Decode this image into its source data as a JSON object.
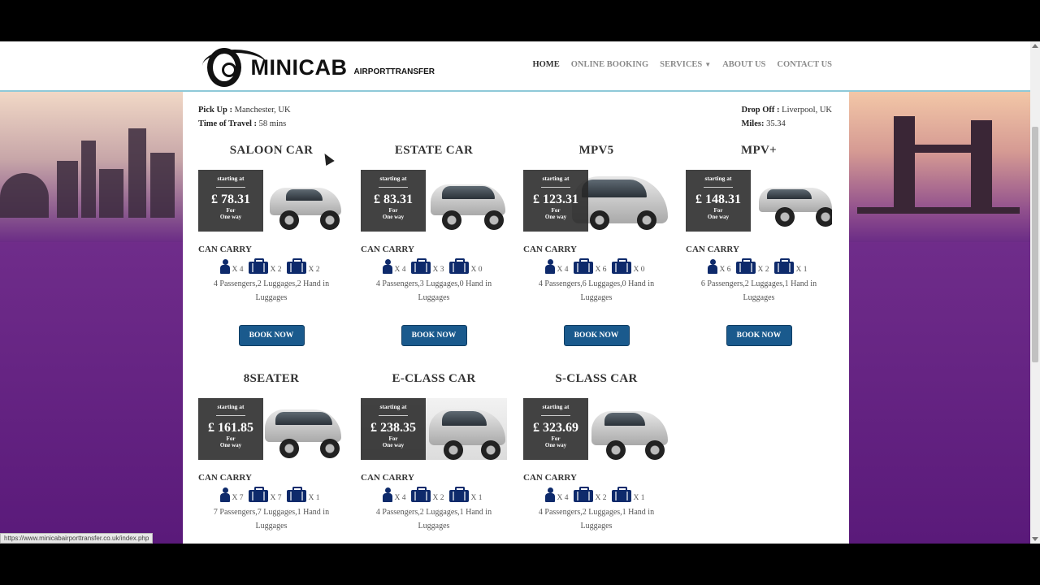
{
  "header": {
    "logo_main": "MINICAB",
    "logo_sub": "AIRPORTTRANSFER",
    "nav": [
      {
        "label": "HOME",
        "active": true
      },
      {
        "label": "ONLINE BOOKING"
      },
      {
        "label": "SERVICES"
      },
      {
        "label": "ABOUT US"
      },
      {
        "label": "CONTACT US"
      }
    ]
  },
  "trip": {
    "pickup_label": "Pick Up :",
    "pickup_value": "Manchester, UK",
    "time_label": "Time of Travel :",
    "time_value": "58 mins",
    "dropoff_label": "Drop Off :",
    "dropoff_value": "Liverpool, UK",
    "miles_label": "Miles:",
    "miles_value": "35.34"
  },
  "labels": {
    "starting_at": "starting at",
    "for": "For",
    "one_way": "One way",
    "can_carry": "CAN CARRY",
    "book_now": "BOOK NOW"
  },
  "cars": [
    {
      "name": "SALOON CAR",
      "price": "£ 78.31",
      "passengers": "X 4",
      "luggages": "X 2",
      "hand": "X 2",
      "desc": "4 Passengers,2 Luggages,2 Hand in Luggages"
    },
    {
      "name": "ESTATE CAR",
      "price": "£ 83.31",
      "passengers": "X 4",
      "luggages": "X 3",
      "hand": "X 0",
      "desc": "4 Passengers,3 Luggages,0 Hand in Luggages"
    },
    {
      "name": "MPV5",
      "price": "£ 123.31",
      "passengers": "X 4",
      "luggages": "X 6",
      "hand": "X 0",
      "desc": "4 Passengers,6 Luggages,0 Hand in Luggages"
    },
    {
      "name": "MPV+",
      "price": "£ 148.31",
      "passengers": "X 6",
      "luggages": "X 2",
      "hand": "X 1",
      "desc": "6 Passengers,2 Luggages,1 Hand in Luggages"
    },
    {
      "name": "8SEATER",
      "price": "£ 161.85",
      "passengers": "X 7",
      "luggages": "X 7",
      "hand": "X 1",
      "desc": "7 Passengers,7 Luggages,1 Hand in Luggages"
    },
    {
      "name": "E-CLASS CAR",
      "price": "£ 238.35",
      "passengers": "X 4",
      "luggages": "X 2",
      "hand": "X 1",
      "desc": "4 Passengers,2 Luggages,1 Hand in Luggages"
    },
    {
      "name": "S-CLASS CAR",
      "price": "£ 323.69",
      "passengers": "X 4",
      "luggages": "X 2",
      "hand": "X 1",
      "desc": "4 Passengers,2 Luggages,1 Hand in Luggages"
    }
  ],
  "status_url": "https://www.minicabairporttransfer.co.uk/index.php",
  "colors": {
    "book_button": "#1a5a8d",
    "icon": "#0e2a6b",
    "background_purple": "#5a1a7a"
  }
}
